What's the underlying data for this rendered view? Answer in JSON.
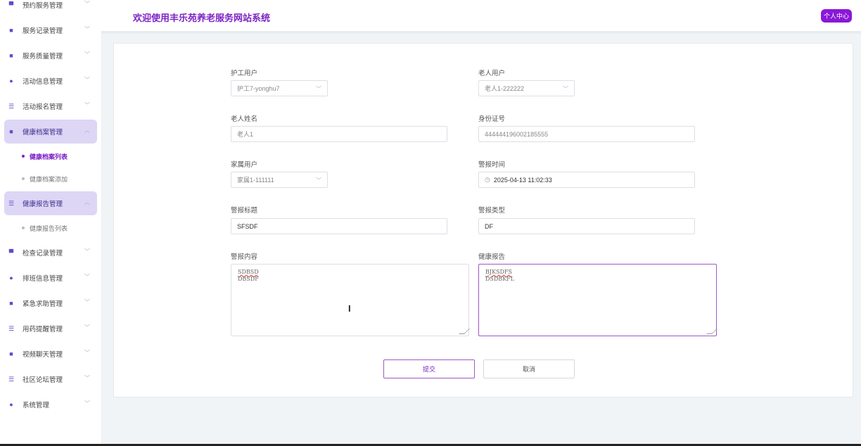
{
  "sidebar": {
    "items": [
      {
        "label": "预约服务管理",
        "icon": "list-icon"
      },
      {
        "label": "服务记录管理",
        "icon": "record-icon"
      },
      {
        "label": "服务质量管理",
        "icon": "quality-icon"
      },
      {
        "label": "活动信息管理",
        "icon": "drop-icon"
      },
      {
        "label": "活动报名管理",
        "icon": "list-icon"
      },
      {
        "label": "健康档案管理",
        "icon": "record-icon",
        "open": true,
        "sub": [
          "健康档案列表",
          "健康档案添加"
        ]
      },
      {
        "label": "健康报告管理",
        "icon": "list-icon",
        "open": true,
        "sub": [
          "健康报告列表"
        ]
      },
      {
        "label": "检查记录管理",
        "icon": "list-icon"
      },
      {
        "label": "排班信息管理",
        "icon": "drop-icon"
      },
      {
        "label": "紧急求助管理",
        "icon": "record-icon"
      },
      {
        "label": "用药提醒管理",
        "icon": "list-icon"
      },
      {
        "label": "视频聊天管理",
        "icon": "record-icon"
      },
      {
        "label": "社区论坛管理",
        "icon": "list-icon"
      },
      {
        "label": "系统管理",
        "icon": "drop-icon"
      }
    ]
  },
  "header": {
    "title": "欢迎使用丰乐苑养老服务网站系统",
    "user_button": "个人中心"
  },
  "form": {
    "caregiver_label": "护工用户",
    "caregiver_value": "护工7-yonghu7",
    "elder_label": "老人用户",
    "elder_value": "老人1-222222",
    "elder_name_label": "老人姓名",
    "elder_name_value": "老人1",
    "id_label": "身份证号",
    "id_value": "444444196002185555",
    "family_label": "家属用户",
    "family_value": "家属1-111111",
    "alarm_time_label": "警报时间",
    "alarm_time_value": "2025-04-13 11:02:33",
    "alarm_title_label": "警报标题",
    "alarm_title_value": "SFSDF",
    "alarm_type_label": "警报类型",
    "alarm_type_value": "DF",
    "alarm_content_label": "警报内容",
    "alarm_content_line1": "SDBSD",
    "alarm_content_line2": "DBSDF",
    "health_report_label": "健康报告",
    "health_report_line1": "BJKSDFS",
    "health_report_line2": "DSDBKFL",
    "submit_label": "提交",
    "cancel_label": "取消"
  },
  "colors": {
    "accent": "#7d24c4",
    "user_button": "#8a17d9"
  }
}
